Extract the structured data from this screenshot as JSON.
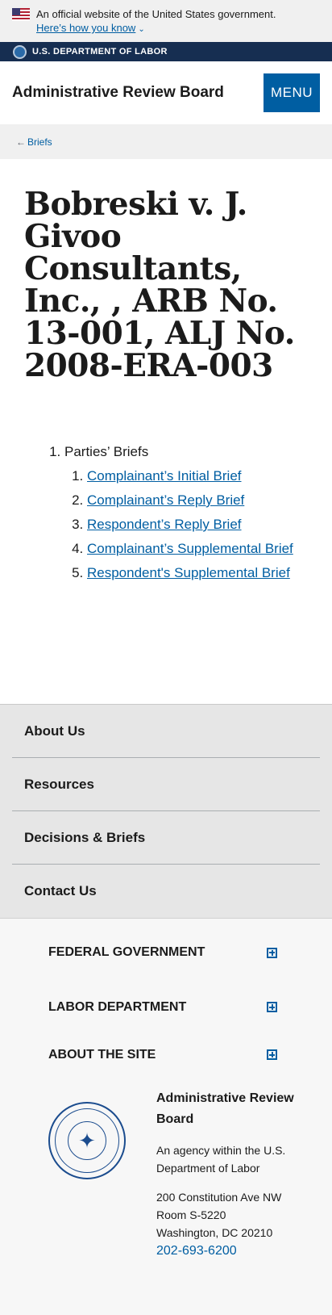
{
  "gov_banner": {
    "text": "An official website of the United States government.",
    "link": "Here’s how you know",
    "chevron": "⌄"
  },
  "dol_bar": {
    "text": "U.S. DEPARTMENT OF LABOR"
  },
  "header": {
    "title": "Administrative Review Board",
    "menu_label": "MENU"
  },
  "breadcrumb": {
    "arrow": "←",
    "label": "Briefs"
  },
  "main": {
    "title": "Bobreski v. J. Givoo Consultants, Inc., , ARB No. 13-001, ALJ No. 2008-ERA-003",
    "section_label": "Parties’ Briefs",
    "briefs": [
      "Complainant’s Initial Brief",
      "Complainant’s Reply Brief",
      "Respondent’s Reply Brief",
      "Complainant’s Supplemental Brief",
      "Respondent's Supplemental Brief"
    ]
  },
  "footer_nav": [
    "About Us",
    "Resources",
    "Decisions & Briefs",
    "Contact Us"
  ],
  "accordion": [
    "FEDERAL GOVERNMENT",
    "LABOR DEPARTMENT",
    "ABOUT THE SITE"
  ],
  "agency": {
    "name": "Administrative Review Board",
    "sub": "An agency within the U.S. Department of Labor",
    "address_line1": "200 Constitution Ave NW",
    "address_line2": "Room S-5220",
    "address_line3": "Washington, DC 20210",
    "phone": "202-693-6200"
  },
  "icons": {
    "flag": "us-flag-icon",
    "seal": "dol-seal-icon",
    "expand": "plus-icon"
  },
  "colors": {
    "primary_blue": "#005ea2",
    "navy": "#162e51",
    "banner_bg": "#f0f0f0"
  }
}
